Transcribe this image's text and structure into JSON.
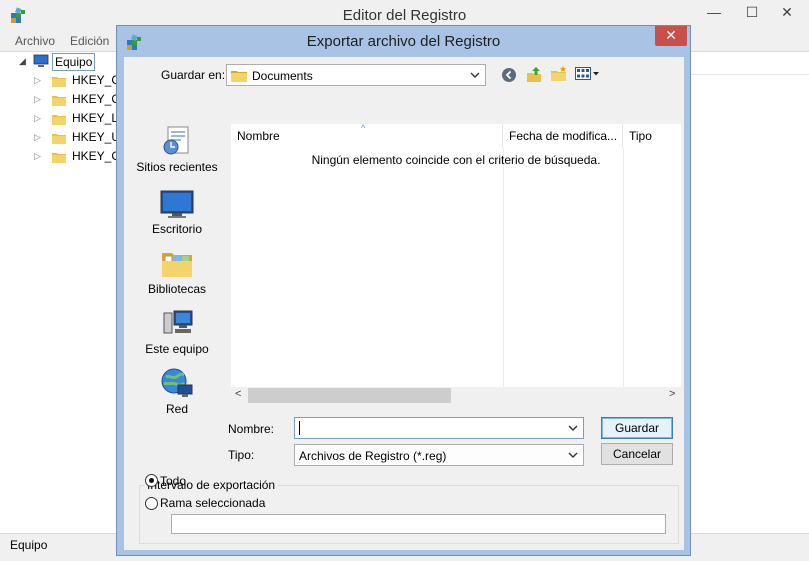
{
  "main_window": {
    "title": "Editor del Registro",
    "controls": {
      "minimize": "—",
      "maximize": "☐",
      "close": "✕"
    },
    "menu": [
      "Archivo",
      "Edición"
    ],
    "tree": {
      "root": "Equipo",
      "children": [
        "HKEY_CL",
        "HKEY_CU",
        "HKEY_LO",
        "HKEY_US",
        "HKEY_CU"
      ]
    },
    "status": "Equipo"
  },
  "dialog": {
    "title": "Exportar archivo del Registro",
    "close": "✕",
    "save_in_label": "Guardar en:",
    "save_in_value": "Documents",
    "places": [
      "Sitios recientes",
      "Escritorio",
      "Bibliotecas",
      "Este equipo",
      "Red"
    ],
    "columns": [
      "Nombre",
      "Fecha de modifica...",
      "Tipo"
    ],
    "empty_message": "Ningún elemento coincide con el criterio de búsqueda.",
    "filename_label": "Nombre:",
    "filename_value": "",
    "type_label": "Tipo:",
    "type_value": "Archivos de Registro (*.reg)",
    "save_button": "Guardar",
    "cancel_button": "Cancelar",
    "export_range": {
      "title": "Intervalo de exportación",
      "option_all": "Todo",
      "option_branch": "Rama seleccionada",
      "branch_value": ""
    }
  },
  "colors": {
    "dialog_frame": "#a9c3e4",
    "close_red": "#c7504b",
    "folder_yellow": "#e8c04a"
  }
}
